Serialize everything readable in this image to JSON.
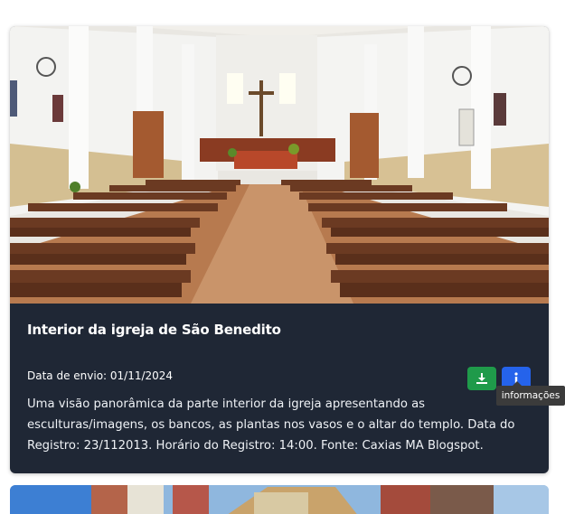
{
  "post": {
    "title": "Interior da igreja de São Benedito",
    "date_label": "Data de envio: 01/11/2024",
    "description": "Uma visão panorâmica da parte interior da igreja apresentando as esculturas/imagens, os bancos, as plantas nos vasos e o altar do templo. Data do Registro: 23/112013. Horário do Registro: 14:00. Fonte: Caxias MA Blogspot.",
    "download_icon": "download-icon",
    "info_icon": "info-icon",
    "tooltip": "informações"
  },
  "colors": {
    "card_bg": "#1f2735",
    "download_button": "#1f9a4a",
    "info_button": "#2563eb"
  }
}
